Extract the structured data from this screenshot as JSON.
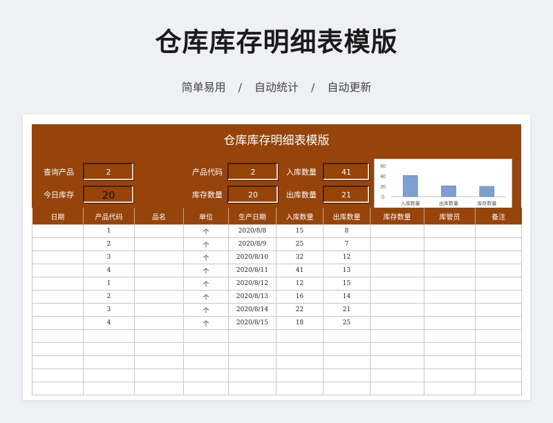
{
  "header": {
    "title": "仓库库存明细表模版",
    "subtitle_items": [
      "简单易用",
      "自动统计",
      "自动更新"
    ],
    "separator": "/"
  },
  "sheet": {
    "title": "仓库库存明细表模版",
    "fields": {
      "query_product_label": "查询产品",
      "query_product_value": "2",
      "today_stock_label": "今日库存",
      "today_stock_value": "20",
      "product_code_label": "产品代码",
      "product_code_value": "2",
      "stock_qty_label": "库存数量",
      "stock_qty_value": "20",
      "in_qty_label": "入库数量",
      "in_qty_value": "41",
      "out_qty_label": "出库数量",
      "out_qty_value": "21"
    },
    "columns": [
      "日期",
      "产品代码",
      "品名",
      "单位",
      "生产日期",
      "入库数量",
      "出库数量",
      "库存数量",
      "库管员",
      "备注"
    ],
    "rows": [
      [
        "",
        "1",
        "",
        "个",
        "2020/8/8",
        "15",
        "8",
        "",
        "",
        ""
      ],
      [
        "",
        "2",
        "",
        "个",
        "2020/8/9",
        "25",
        "7",
        "",
        "",
        ""
      ],
      [
        "",
        "3",
        "",
        "个",
        "2020/8/10",
        "32",
        "12",
        "",
        "",
        ""
      ],
      [
        "",
        "4",
        "",
        "个",
        "2020/8/11",
        "41",
        "13",
        "",
        "",
        ""
      ],
      [
        "",
        "1",
        "",
        "个",
        "2020/8/12",
        "12",
        "15",
        "",
        "",
        ""
      ],
      [
        "",
        "2",
        "",
        "个",
        "2020/8/13",
        "16",
        "14",
        "",
        "",
        ""
      ],
      [
        "",
        "3",
        "",
        "个",
        "2020/8/14",
        "22",
        "21",
        "",
        "",
        ""
      ],
      [
        "",
        "4",
        "",
        "个",
        "2020/8/15",
        "18",
        "25",
        "",
        "",
        ""
      ],
      [
        "",
        "",
        "",
        "",
        "",
        "",
        "",
        "",
        "",
        ""
      ],
      [
        "",
        "",
        "",
        "",
        "",
        "",
        "",
        "",
        "",
        ""
      ],
      [
        "",
        "",
        "",
        "",
        "",
        "",
        "",
        "",
        "",
        ""
      ],
      [
        "",
        "",
        "",
        "",
        "",
        "",
        "",
        "",
        "",
        ""
      ],
      [
        "",
        "",
        "",
        "",
        "",
        "",
        "",
        "",
        "",
        ""
      ]
    ]
  },
  "chart_data": {
    "type": "bar",
    "categories": [
      "入库数量",
      "出库数量",
      "库存数量"
    ],
    "values": [
      41,
      21,
      20
    ],
    "ylim": [
      0,
      60
    ],
    "yticks": [
      "60",
      "40",
      "20",
      "0"
    ],
    "bar_color": "#7f9fcf",
    "grid": false
  },
  "colors": {
    "panel": "#964409",
    "background": "#eef0f3"
  }
}
